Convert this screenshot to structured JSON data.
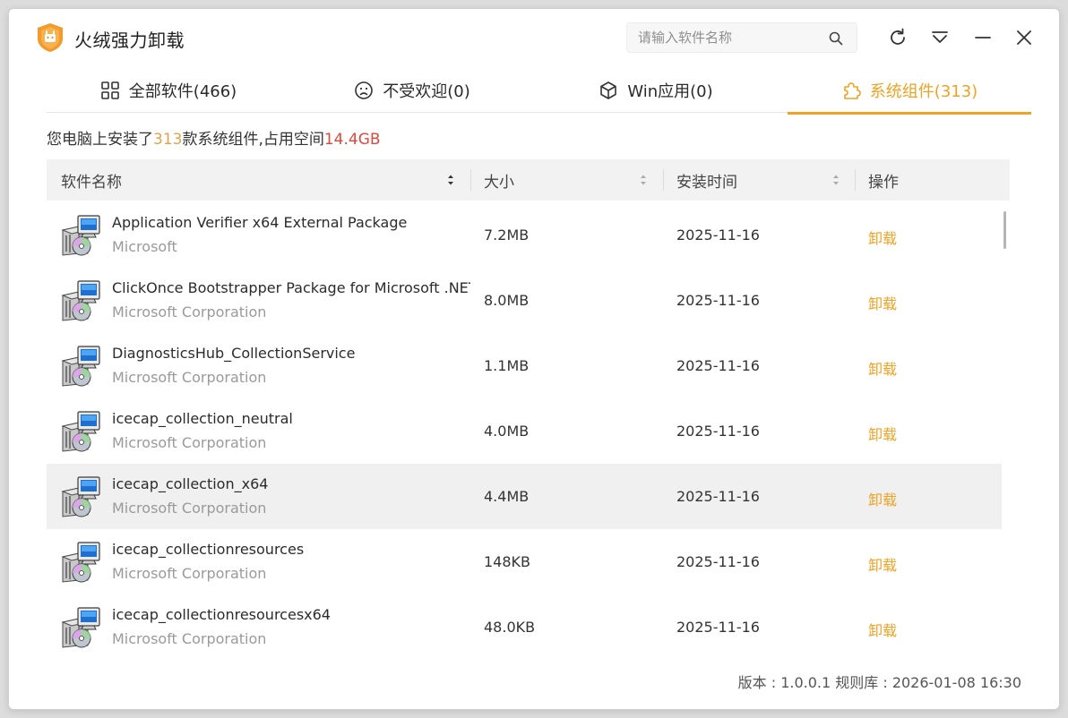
{
  "app": {
    "title": "火绒强力卸载"
  },
  "search": {
    "placeholder": "请输入软件名称",
    "value": ""
  },
  "window_controls": [
    "refresh-icon",
    "menu-icon",
    "minimize-icon",
    "close-icon"
  ],
  "tabs": [
    {
      "label": "全部软件(466)",
      "icon": "grid-icon",
      "active": false
    },
    {
      "label": "不受欢迎(0)",
      "icon": "sad-face-icon",
      "active": false
    },
    {
      "label": "Win应用(0)",
      "icon": "cube-icon",
      "active": false
    },
    {
      "label": "系统组件(313)",
      "icon": "puzzle-icon",
      "active": true
    }
  ],
  "summary": {
    "prefix": "您电脑上安装了",
    "count": "313",
    "middle": "款系统组件,占用空间",
    "size": "14.4GB"
  },
  "table": {
    "columns": [
      "软件名称",
      "大小",
      "安装时间",
      "操作"
    ],
    "rows": [
      {
        "name": "Application Verifier x64 External Package",
        "publisher": "Microsoft",
        "size": "7.2MB",
        "date": "2025-11-16",
        "action": "卸载"
      },
      {
        "name": "ClickOnce Bootstrapper Package for Microsoft .NET...",
        "publisher": "Microsoft Corporation",
        "size": "8.0MB",
        "date": "2025-11-16",
        "action": "卸载"
      },
      {
        "name": "DiagnosticsHub_CollectionService",
        "publisher": "Microsoft Corporation",
        "size": "1.1MB",
        "date": "2025-11-16",
        "action": "卸载"
      },
      {
        "name": "icecap_collection_neutral",
        "publisher": "Microsoft Corporation",
        "size": "4.0MB",
        "date": "2025-11-16",
        "action": "卸载"
      },
      {
        "name": "icecap_collection_x64",
        "publisher": "Microsoft Corporation",
        "size": "4.4MB",
        "date": "2025-11-16",
        "action": "卸载"
      },
      {
        "name": "icecap_collectionresources",
        "publisher": "Microsoft Corporation",
        "size": "148KB",
        "date": "2025-11-16",
        "action": "卸载"
      },
      {
        "name": "icecap_collectionresourcesx64",
        "publisher": "Microsoft Corporation",
        "size": "48.0KB",
        "date": "2025-11-16",
        "action": "卸载"
      }
    ]
  },
  "footer": {
    "text": "版本 : 1.0.0.1   规则库 : 2026-01-08 16:30"
  },
  "colors": {
    "accent": "#f0a223",
    "count_highlight": "#e3a34a",
    "size_highlight": "#e0483b"
  }
}
